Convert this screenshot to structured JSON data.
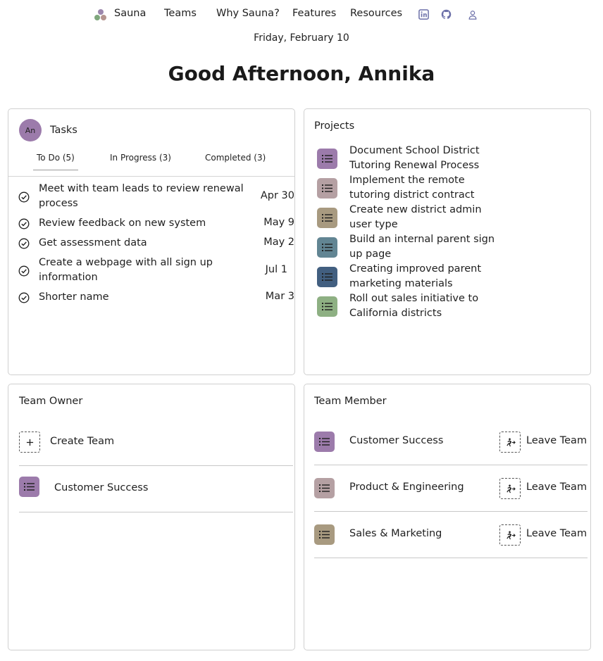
{
  "nav": {
    "brand": "Sauna",
    "links": [
      "Teams",
      "Why Sauna?",
      "Features",
      "Resources"
    ],
    "icons": [
      "linkedin-icon",
      "github-icon",
      "user-icon"
    ],
    "icon_color": "#6b6fa8"
  },
  "date": "Friday, February 10",
  "greeting": "Good Afternoon, Annika",
  "tasks": {
    "avatar": "An",
    "title": "Tasks",
    "tabs": [
      "To Do (5)",
      "In Progress (3)",
      "Completed (3)"
    ],
    "active_tab": "To Do (5)",
    "items": [
      {
        "title": "Meet with team leads to review renewal process",
        "due": "Apr 30"
      },
      {
        "title": "Review feedback on new system",
        "due": "May 9"
      },
      {
        "title": "Get assessment data",
        "due": "May 2"
      },
      {
        "title": "Create a webpage with all sign up information",
        "due": "Jul 1"
      },
      {
        "title": "Shorter name",
        "due": "Mar 3"
      }
    ]
  },
  "projects": {
    "title": "Projects",
    "items": [
      {
        "title": "Document School District Tutoring Renewal Process",
        "color": "#9c7bab"
      },
      {
        "title": "Implement the remote tutoring district contract",
        "color": "#b5a0a3"
      },
      {
        "title": "Create new district admin user type",
        "color": "#a89a80"
      },
      {
        "title": "Build an internal parent sign up page",
        "color": "#628593"
      },
      {
        "title": "Creating improved parent marketing materials",
        "color": "#425f80"
      },
      {
        "title": "Roll out sales initiative to California districts",
        "color": "#8eb083"
      }
    ]
  },
  "team_owner": {
    "title": "Team Owner",
    "create_label": "Create Team",
    "teams": [
      {
        "name": "Customer Success",
        "color": "#9c7bab"
      }
    ]
  },
  "team_member": {
    "title": "Team Member",
    "leave_label": "Leave Team",
    "teams": [
      {
        "name": "Customer Success",
        "color": "#9c7bab"
      },
      {
        "name": "Product & Engineering",
        "color": "#b5a0a3"
      },
      {
        "name": "Sales & Marketing",
        "color": "#a89a80"
      }
    ]
  }
}
